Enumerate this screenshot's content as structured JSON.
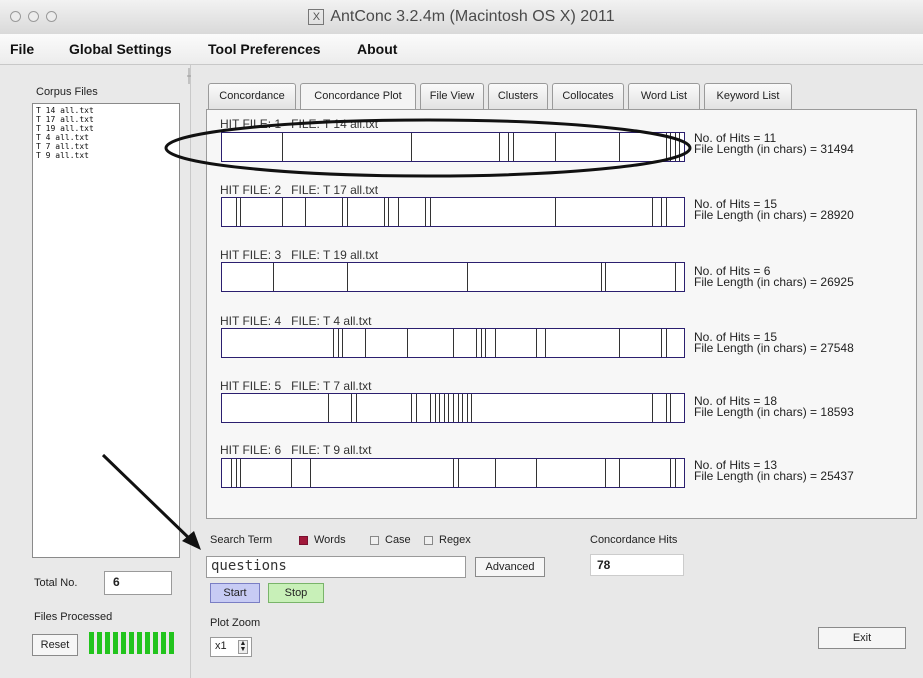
{
  "window": {
    "title": "AntConc 3.2.4m (Macintosh OS X) 2011"
  },
  "menu": [
    "File",
    "Global Settings",
    "Tool Preferences",
    "About"
  ],
  "sidebar": {
    "corpus_label": "Corpus Files",
    "files": [
      "T 14 all.txt",
      "T 17 all.txt",
      "T 19 all.txt",
      "T 4 all.txt",
      "T 7 all.txt",
      "T 9 all.txt"
    ],
    "total_label": "Total No.",
    "total_value": "6",
    "files_processed_label": "Files Processed",
    "reset_label": "Reset",
    "progress_fraction": 1.0
  },
  "tabs": [
    "Concordance",
    "Concordance Plot",
    "File View",
    "Clusters",
    "Collocates",
    "Word List",
    "Keyword List"
  ],
  "active_tab": "Concordance Plot",
  "plots": [
    {
      "hit_file": "HIT FILE: 1",
      "file": "FILE: T 14 all.txt",
      "hits": "No. of Hits = 11",
      "length": "File Length (in chars) = 31494",
      "hit_positions": [
        0.13,
        0.41,
        0.6,
        0.62,
        0.63,
        0.72,
        0.86,
        0.96,
        0.97,
        0.98,
        0.99
      ]
    },
    {
      "hit_file": "HIT FILE: 2",
      "file": "FILE: T 17 all.txt",
      "hits": "No. of Hits = 15",
      "length": "File Length (in chars) = 28920",
      "hit_positions": [
        0.03,
        0.04,
        0.13,
        0.18,
        0.26,
        0.27,
        0.35,
        0.36,
        0.38,
        0.44,
        0.45,
        0.72,
        0.93,
        0.95,
        0.96
      ]
    },
    {
      "hit_file": "HIT FILE: 3",
      "file": "FILE: T 19 all.txt",
      "hits": "No. of Hits = 6",
      "length": "File Length (in chars) = 26925",
      "hit_positions": [
        0.11,
        0.27,
        0.53,
        0.82,
        0.83,
        0.98
      ]
    },
    {
      "hit_file": "HIT FILE: 4",
      "file": "FILE: T 4 all.txt",
      "hits": "No. of Hits = 15",
      "length": "File Length (in chars) = 27548",
      "hit_positions": [
        0.24,
        0.25,
        0.26,
        0.31,
        0.4,
        0.5,
        0.55,
        0.56,
        0.57,
        0.59,
        0.68,
        0.7,
        0.86,
        0.95,
        0.96
      ]
    },
    {
      "hit_file": "HIT FILE: 5",
      "file": "FILE: T 7 all.txt",
      "hits": "No. of Hits = 18",
      "length": "File Length (in chars) = 18593",
      "hit_positions": [
        0.23,
        0.28,
        0.29,
        0.41,
        0.42,
        0.45,
        0.46,
        0.47,
        0.48,
        0.49,
        0.5,
        0.51,
        0.52,
        0.53,
        0.54,
        0.93,
        0.96,
        0.97
      ]
    },
    {
      "hit_file": "HIT FILE: 6",
      "file": "FILE: T 9 all.txt",
      "hits": "No. of Hits = 13",
      "length": "File Length (in chars) = 25437",
      "hit_positions": [
        0.02,
        0.03,
        0.04,
        0.15,
        0.19,
        0.5,
        0.51,
        0.59,
        0.68,
        0.83,
        0.86,
        0.97,
        0.98
      ]
    }
  ],
  "search": {
    "term_label": "Search Term",
    "words_label": "Words",
    "words_checked": true,
    "case_label": "Case",
    "case_checked": false,
    "regex_label": "Regex",
    "regex_checked": false,
    "value": "questions",
    "advanced_label": "Advanced",
    "hits_label": "Concordance Hits",
    "hits_value": "78",
    "start_label": "Start",
    "stop_label": "Stop",
    "zoom_label": "Plot Zoom",
    "zoom_value": "x1",
    "exit_label": "Exit"
  },
  "colors": {
    "bar_border": "#2b1f6f",
    "start_button": "#c7cbf4",
    "stop_button": "#c8f0b8",
    "progress": "#22c41d",
    "words_checkbox": "#a2193b"
  }
}
